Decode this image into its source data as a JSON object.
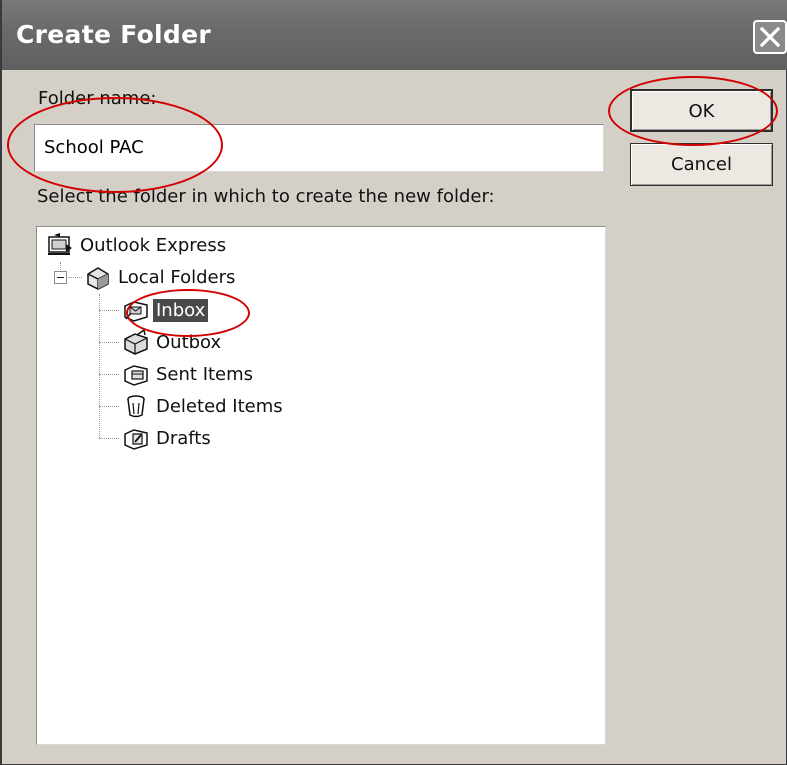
{
  "dialog": {
    "title": "Create Folder",
    "close_icon": "close-icon"
  },
  "form": {
    "folder_name_label": "Folder name:",
    "folder_name_value": "School PAC",
    "select_label": "Select the folder in which to create the new folder:"
  },
  "buttons": {
    "ok": "OK",
    "cancel": "Cancel"
  },
  "tree": {
    "root": {
      "label": "Outlook Express",
      "icon": "outlook-express-icon"
    },
    "local": {
      "label": "Local Folders",
      "icon": "local-folders-icon",
      "expanded": true
    },
    "items": [
      {
        "label": "Inbox",
        "icon": "inbox-icon",
        "selected": true
      },
      {
        "label": "Outbox",
        "icon": "outbox-icon"
      },
      {
        "label": "Sent Items",
        "icon": "sent-items-icon"
      },
      {
        "label": "Deleted Items",
        "icon": "deleted-items-icon"
      },
      {
        "label": "Drafts",
        "icon": "drafts-icon"
      }
    ]
  },
  "annotation_color": "#d20000",
  "selection_color": "#4a4a4a"
}
